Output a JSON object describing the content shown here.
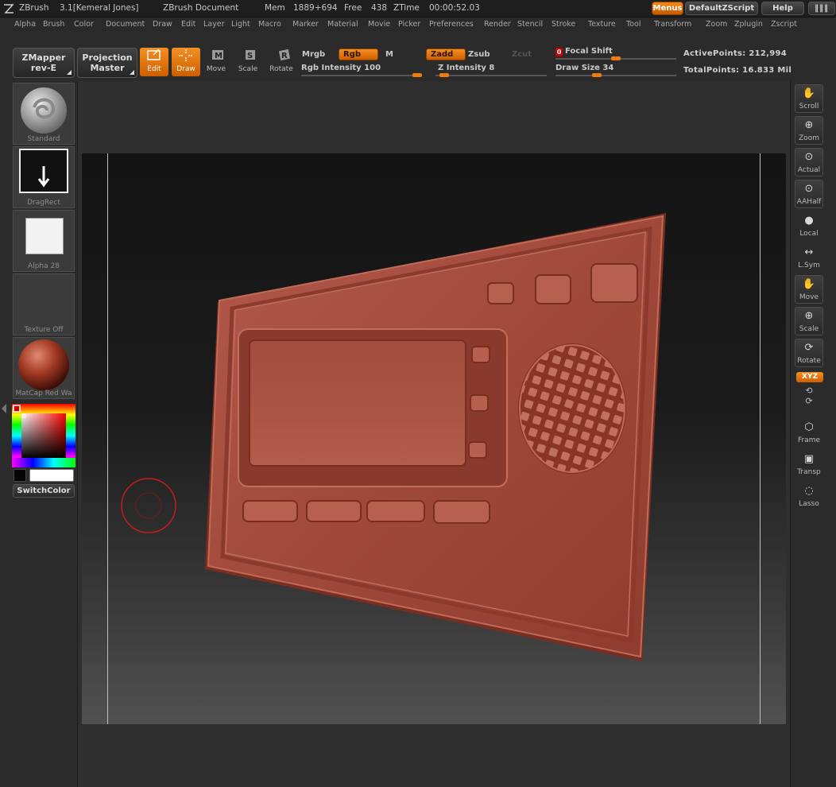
{
  "titlebar": {
    "app": "ZBrush",
    "version": "3.1[Kemeral Jones]",
    "document": "ZBrush Document",
    "mem_label": "Mem",
    "mem_value": "1889+694",
    "free_label": "Free",
    "free_value": "438",
    "ztime_label": "ZTime",
    "ztime_value": "00:00:52.03",
    "menus_btn": "Menus",
    "script_btn": "DefaultZScript",
    "help_btn": "Help"
  },
  "menubar": [
    "Alpha",
    "Brush",
    "Color",
    "Document",
    "Draw",
    "Edit",
    "Layer",
    "Light",
    "Macro",
    "Marker",
    "Material",
    "Movie",
    "Picker",
    "Preferences",
    "Render",
    "Stencil",
    "Stroke",
    "Texture",
    "Tool",
    "Transform",
    "Zoom",
    "Zplugin",
    "Zscript"
  ],
  "toolbar": {
    "zmapper_line1": "ZMapper",
    "zmapper_line2": "rev-E",
    "projection_line1": "Projection",
    "projection_line2": "Master",
    "edit": "Edit",
    "draw": "Draw",
    "move": "Move",
    "scale": "Scale",
    "rotate": "Rotate",
    "mrgb": "Mrgb",
    "rgb": "Rgb",
    "m": "M",
    "zadd": "Zadd",
    "zsub": "Zsub",
    "zcut": "Zcut",
    "rgb_intensity": "Rgb  Intensity 100",
    "z_intensity": "Z  Intensity 8",
    "focal_shift_value": "0",
    "focal_shift": "Focal  Shift",
    "draw_size": "Draw  Size 34",
    "active_points": "ActivePoints: 212,994",
    "total_points": "TotalPoints: 16.833  Mil",
    "rgb_intensity_level": 1.0,
    "z_intensity_level": 0.08,
    "focal_shift_level": 0.5,
    "draw_size_level": 0.34
  },
  "lefttray": {
    "brush": "Standard",
    "stroke": "DragRect",
    "alpha": "Alpha  28",
    "texture": "Texture  Off",
    "material": "MatCap  Red  Wa",
    "switch_color": "SwitchColor"
  },
  "rightshelf": {
    "scroll": "Scroll",
    "zoom": "Zoom",
    "actual": "Actual",
    "aahalf": "AAHalf",
    "local": "Local",
    "lsym": "L.Sym",
    "move": "Move",
    "scale": "Scale",
    "rotate": "Rotate",
    "xyz": "XYZ",
    "frame": "Frame",
    "transp": "Transp",
    "lasso": "Lasso"
  },
  "colors": {
    "accent": "#f08a1a",
    "model": "#a24a3a",
    "brush_cursor": "#c0201a"
  }
}
